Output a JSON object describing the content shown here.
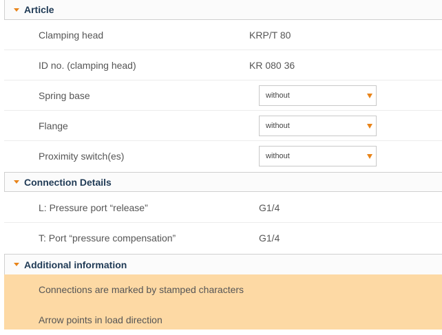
{
  "article": {
    "title": "Article",
    "rows": [
      {
        "label": "Clamping head",
        "value": "KRP/T 80"
      },
      {
        "label": "ID no. (clamping head)",
        "value": "KR 080 36"
      }
    ],
    "selects": [
      {
        "label": "Spring base",
        "selected": "without"
      },
      {
        "label": "Flange",
        "selected": "without"
      },
      {
        "label": "Proximity switch(es)",
        "selected": "without"
      }
    ]
  },
  "connection": {
    "title": "Connection Details",
    "rows": [
      {
        "label": "L: Pressure port “release”",
        "value": "G1/4"
      },
      {
        "label": "T: Port “pressure compensation”",
        "value": "G1/4"
      }
    ]
  },
  "additional": {
    "title": "Additional information",
    "items": [
      "Connections are marked by stamped characters",
      "Arrow points in load direction"
    ]
  },
  "colors": {
    "accent": "#e8841a",
    "header_text": "#1f3a55",
    "highlight": "#fdd9a4"
  }
}
